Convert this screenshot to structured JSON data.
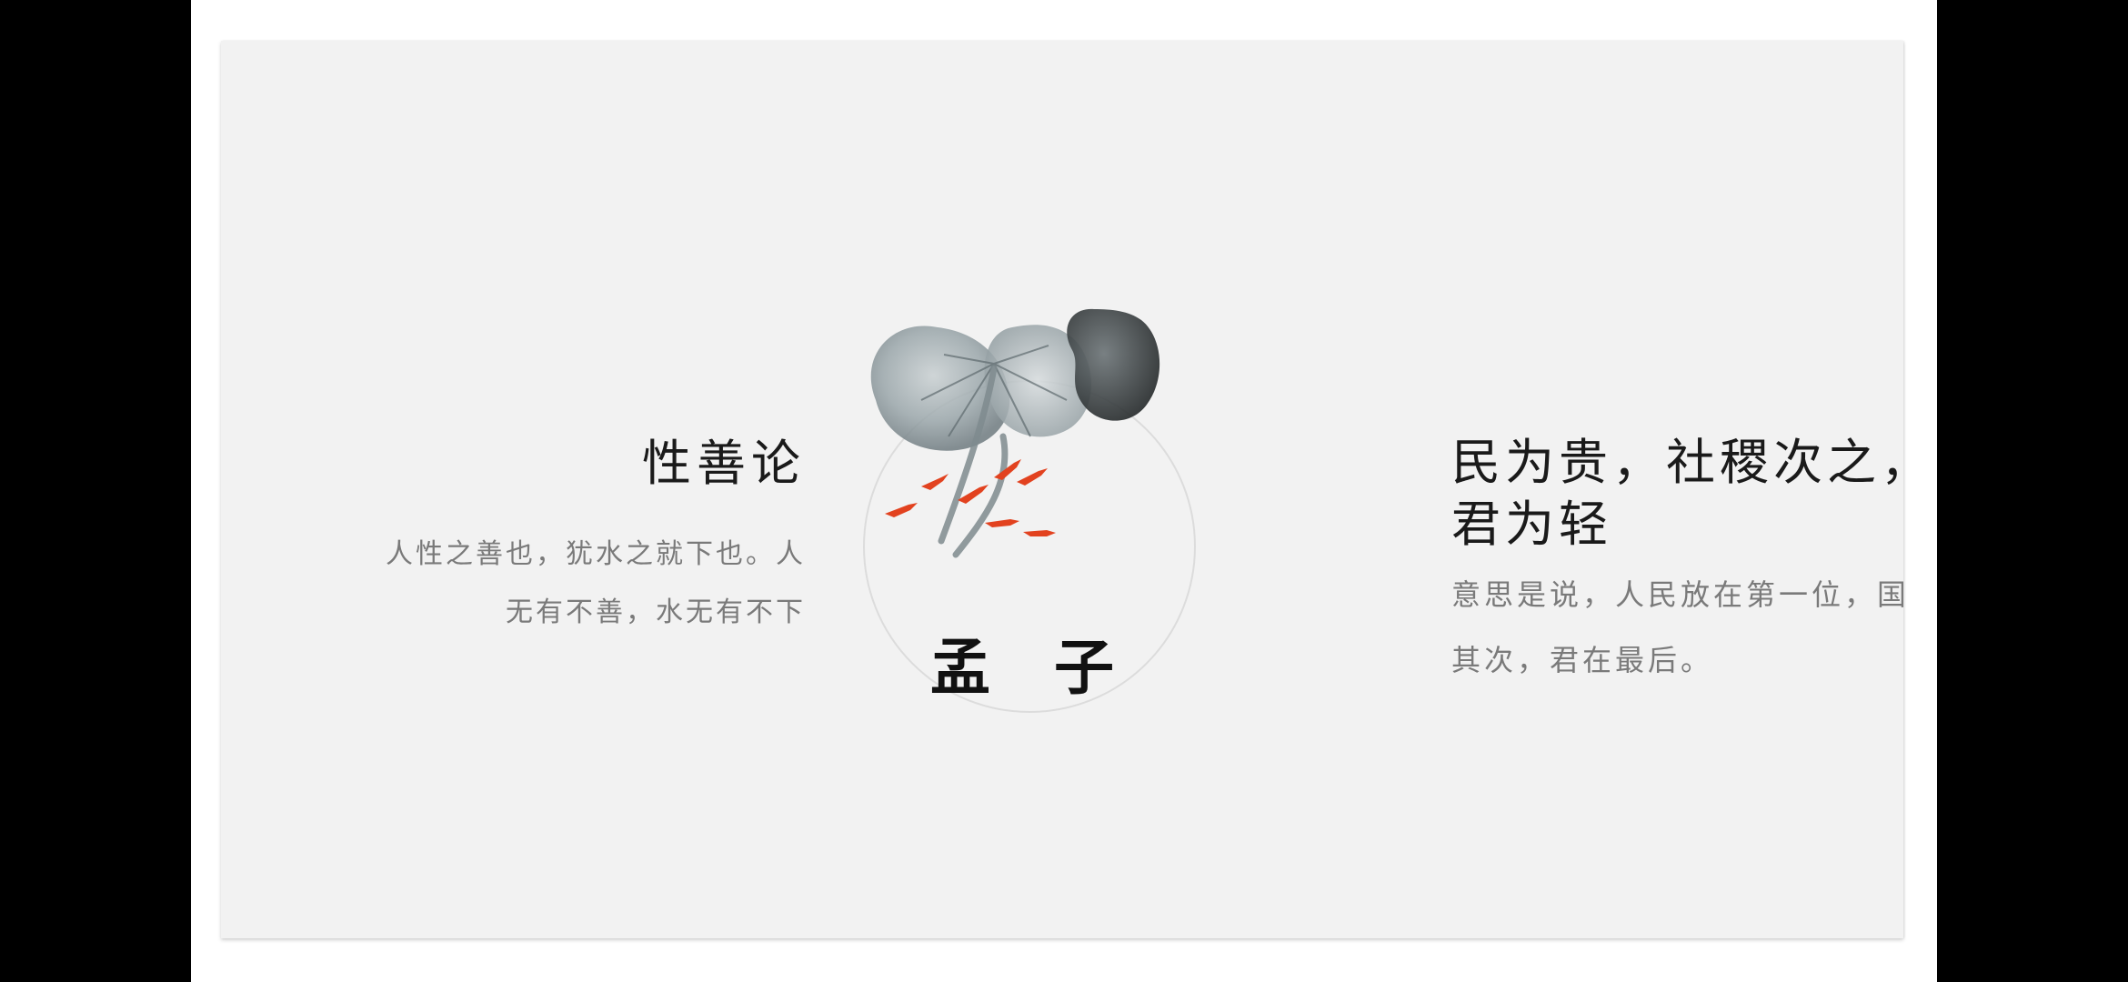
{
  "slide": {
    "left": {
      "heading": "性善论",
      "body_lines": [
        "人性之善也，犹水之就下也。人",
        "无有不善，水无有不下"
      ]
    },
    "center": {
      "name": "孟子",
      "illustration": "ink-lotus-leaf-and-red-fish"
    },
    "right": {
      "heading_lines": [
        "民为贵，社稷次之，",
        "君为轻"
      ],
      "body_lines": [
        "意思是说，人民放在第一位，国家",
        "其次，君在最后。"
      ]
    }
  },
  "colors": {
    "slide_bg": "#f2f2f2",
    "heading": "#1a1a1a",
    "body": "#7a7a7a",
    "accent_fish": "#e2421f"
  }
}
